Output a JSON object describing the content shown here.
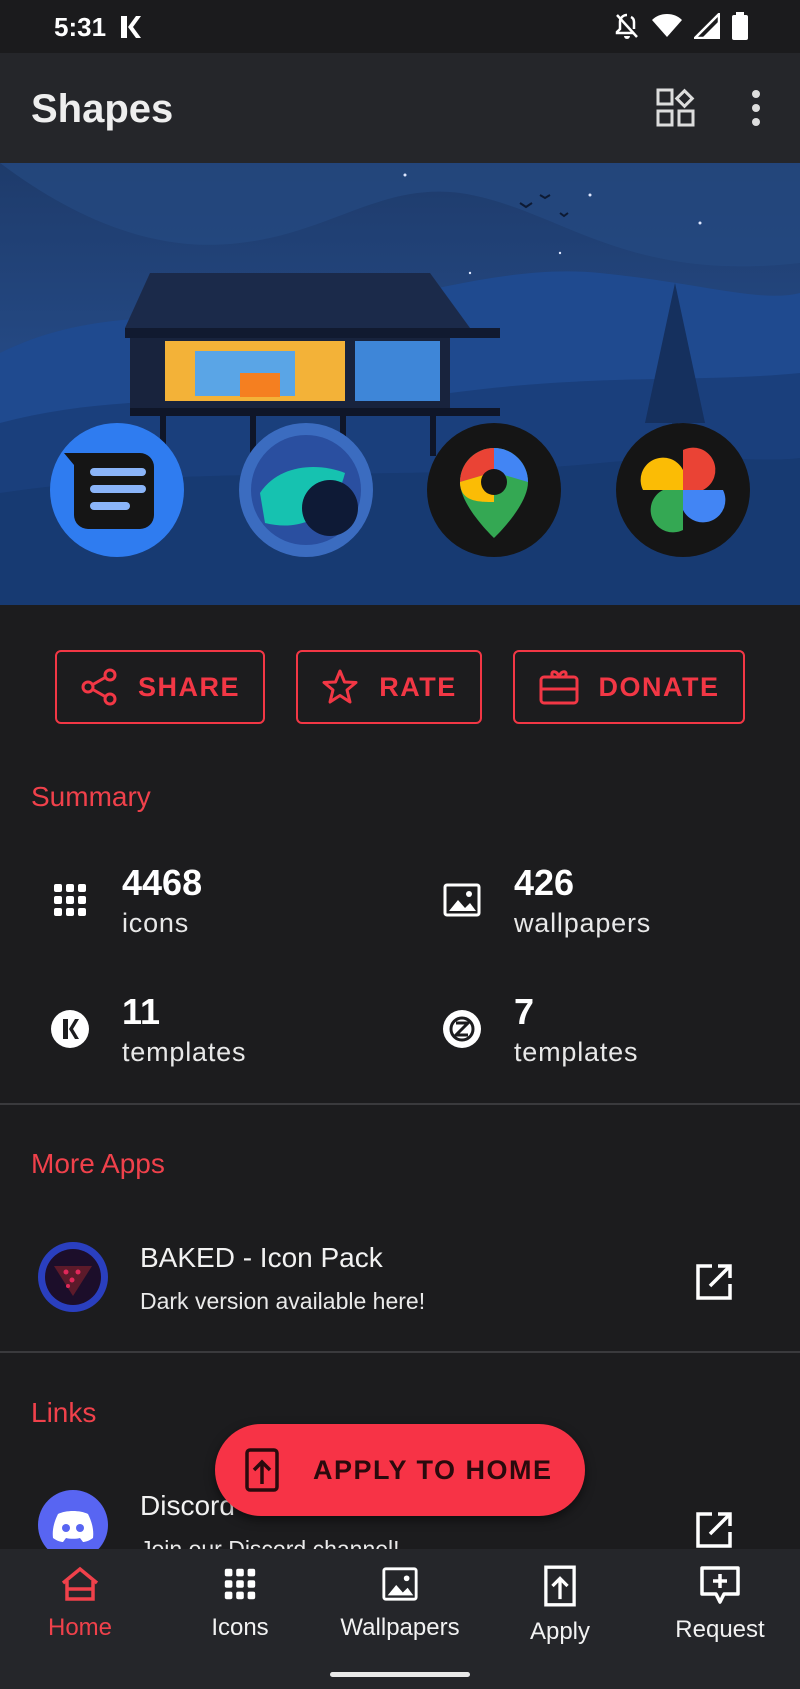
{
  "status": {
    "time": "5:31"
  },
  "appbar": {
    "title": "Shapes"
  },
  "actions": {
    "share": "SHARE",
    "rate": "RATE",
    "donate": "DONATE"
  },
  "summary": {
    "title": "Summary",
    "items": [
      {
        "icon": "grid-icon",
        "value": "4468",
        "label": "icons"
      },
      {
        "icon": "image-icon",
        "value": "426",
        "label": "wallpapers"
      },
      {
        "icon": "kwgt-icon",
        "value": "11",
        "label": "templates"
      },
      {
        "icon": "zooper-icon",
        "value": "7",
        "label": "templates"
      }
    ]
  },
  "more_apps": {
    "title": "More Apps",
    "items": [
      {
        "title": "BAKED - Icon Pack",
        "subtitle": "Dark version available here!"
      }
    ]
  },
  "links": {
    "title": "Links",
    "items": [
      {
        "title": "Discord",
        "subtitle": "Join our Discord channel!"
      }
    ]
  },
  "fab": {
    "label": "APPLY TO HOME"
  },
  "nav": {
    "items": [
      {
        "label": "Home"
      },
      {
        "label": "Icons"
      },
      {
        "label": "Wallpapers"
      },
      {
        "label": "Apply"
      },
      {
        "label": "Request"
      }
    ]
  },
  "colors": {
    "accent": "#f23745",
    "background": "#1c1c1e",
    "appbar": "#25262a"
  }
}
